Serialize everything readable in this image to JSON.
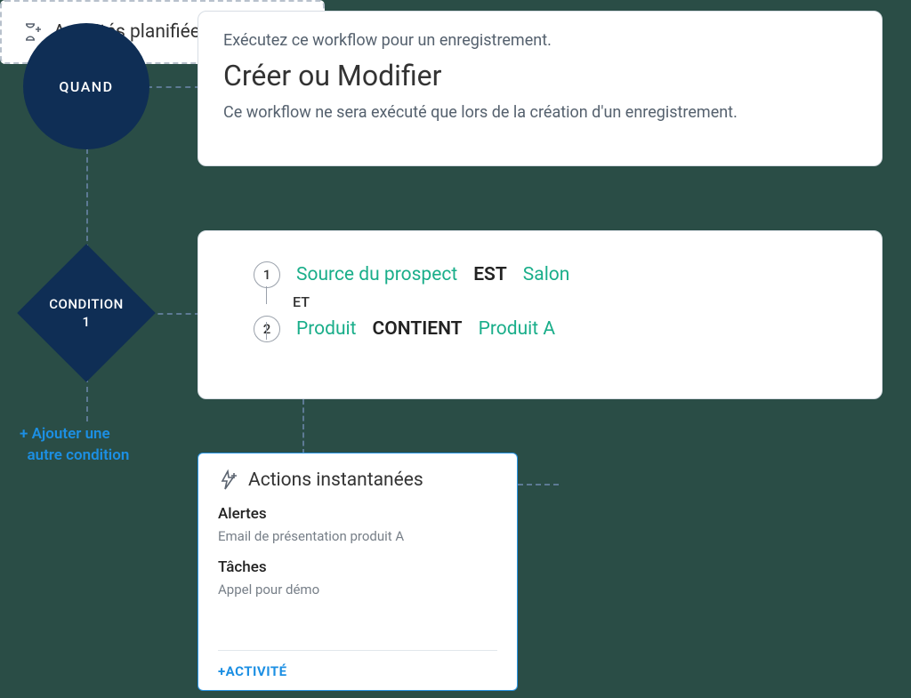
{
  "when": {
    "node_label": "QUAND",
    "line1": "Exécutez ce workflow pour un enregistrement.",
    "title": "Créer ou Modifier",
    "line2": "Ce workflow ne sera exécuté que lors de la création d'un enregistrement."
  },
  "condition": {
    "node_label_top": "CONDITION",
    "node_label_bottom": "1",
    "and": "ET",
    "criteria": [
      {
        "num": "1",
        "field": "Source du prospect",
        "op": "EST",
        "value": "Salon"
      },
      {
        "num": "2",
        "field": "Produit",
        "op": "CONTIENT",
        "value": "Produit A"
      }
    ]
  },
  "add_condition": {
    "line1": "+ Ajouter une",
    "line2": "autre condition"
  },
  "actions": {
    "title": "Actions instantanées",
    "sections": [
      {
        "title": "Alertes",
        "item": "Email de présentation produit A"
      },
      {
        "title": "Tâches",
        "item": "Appel pour démo"
      }
    ],
    "footer": "+ACTIVITÉ"
  },
  "scheduled": {
    "title": "Activités planifiées"
  }
}
